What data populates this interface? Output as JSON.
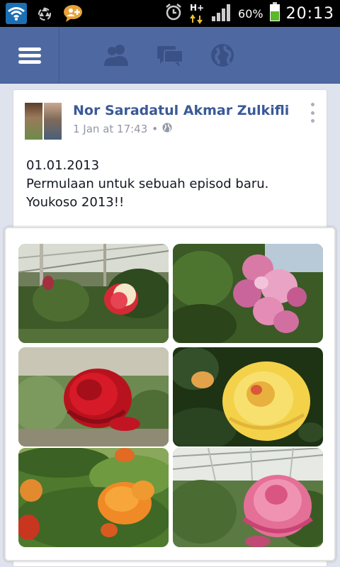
{
  "status_bar": {
    "icons_left": [
      "wifi-icon",
      "recycle-icon",
      "chat-add-icon"
    ],
    "network": "H+",
    "battery": "60%",
    "time": "20:13"
  },
  "top_bar": {
    "icons": [
      "menu-icon",
      "friends-icon",
      "messages-icon",
      "globe-icon"
    ],
    "color": "#4e69a2"
  },
  "post": {
    "author": "Nor Saradatul Akmar Zulkifli",
    "date": "1 Jan at 17:43",
    "separator": "•",
    "privacy_icon": "globe-icon",
    "text_lines": [
      "01.01.2013",
      "Permulaan untuk sebuah episod baru.",
      "Youkoso 2013!!"
    ],
    "photos": [
      "rose-greenhouse",
      "pink-roses",
      "red-rose",
      "yellow-rose",
      "orange-roses-garden",
      "pink-rose-greenhouse"
    ]
  }
}
